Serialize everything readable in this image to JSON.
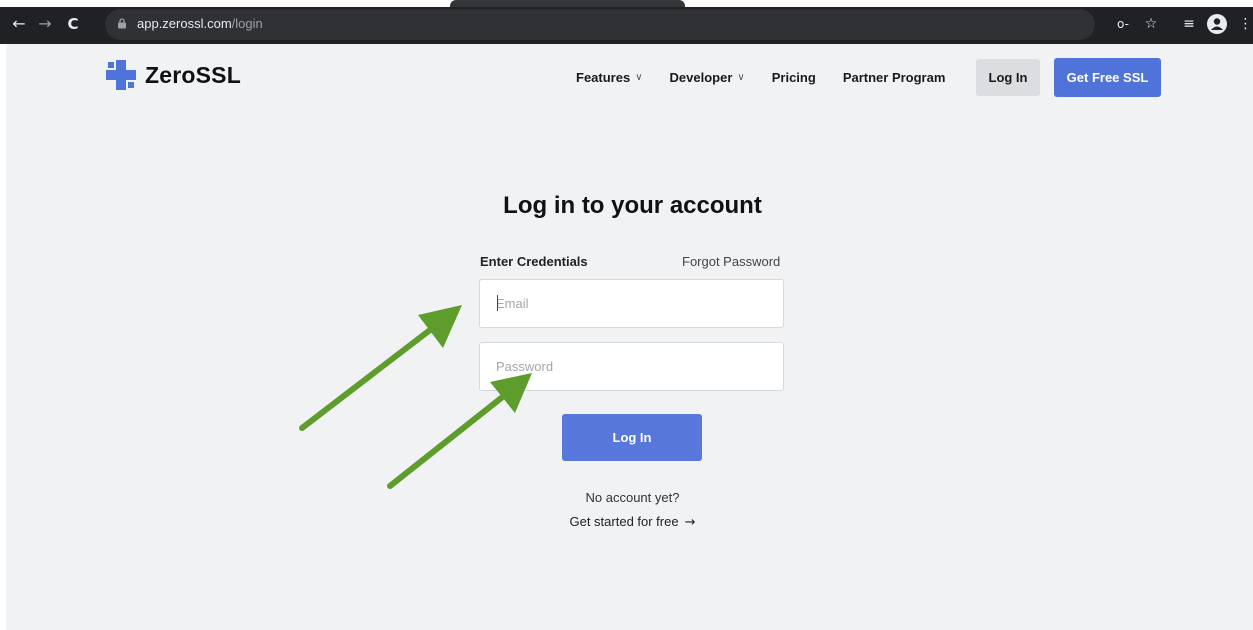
{
  "browser": {
    "back_icon": "←",
    "forward_icon": "→",
    "reload_icon": "C",
    "url_domain": "app.zerossl.com",
    "url_path": "/login",
    "key_icon": "o-",
    "star_icon": "☆",
    "media_icon": "≡",
    "menu_icon": "⋮"
  },
  "header": {
    "logo_text": "ZeroSSL",
    "nav": [
      {
        "label": "Features",
        "has_dropdown": true
      },
      {
        "label": "Developer",
        "has_dropdown": true
      },
      {
        "label": "Pricing",
        "has_dropdown": false
      },
      {
        "label": "Partner Program",
        "has_dropdown": false
      }
    ],
    "login_label": "Log In",
    "cta_label": "Get Free SSL",
    "chevron": "∨"
  },
  "login": {
    "title": "Log in to your account",
    "credentials_label": "Enter Credentials",
    "forgot_label": "Forgot Password",
    "email_placeholder": "Email",
    "password_placeholder": "Password",
    "submit_label": "Log In",
    "no_account": "No account yet?",
    "get_started": "Get started for free",
    "arrow": "→"
  },
  "colors": {
    "brand": "#4f73d9",
    "annotation_arrow": "#5e9c2c",
    "page_bg": "#f1f2f4"
  }
}
